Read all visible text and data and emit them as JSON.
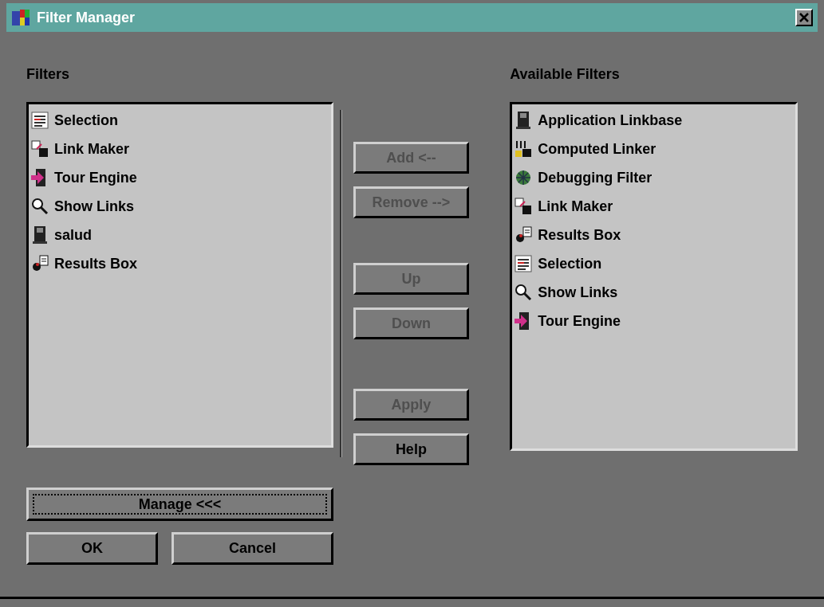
{
  "window": {
    "title": "Filter Manager"
  },
  "filters": {
    "label": "Filters",
    "items": [
      {
        "label": "Selection",
        "kind": "selection"
      },
      {
        "label": "Link Maker",
        "kind": "linker"
      },
      {
        "label": "Tour Engine",
        "kind": "tour"
      },
      {
        "label": "Show Links",
        "kind": "search"
      },
      {
        "label": "salud",
        "kind": "linkbase"
      },
      {
        "label": "Results Box",
        "kind": "results"
      }
    ]
  },
  "button_groups": [
    [
      {
        "label": "Add <--",
        "disabled": true
      },
      {
        "label": "Remove -->",
        "disabled": true
      }
    ],
    [
      {
        "label": "Up",
        "disabled": true
      },
      {
        "label": "Down",
        "disabled": true
      }
    ],
    [
      {
        "label": "Apply",
        "disabled": true
      }
    ],
    [
      {
        "label": "Help",
        "disabled": false
      }
    ]
  ],
  "available_filters": {
    "label": "Available Filters",
    "items": [
      {
        "label": "Application Linkbase",
        "kind": "linkbase"
      },
      {
        "label": "Computed Linker",
        "kind": "computed"
      },
      {
        "label": "Debugging Filter",
        "kind": "debug"
      },
      {
        "label": "Link Maker",
        "kind": "linker"
      },
      {
        "label": "Results Box",
        "kind": "results"
      },
      {
        "label": "Selection",
        "kind": "selection"
      },
      {
        "label": "Show Links",
        "kind": "search"
      },
      {
        "label": "Tour Engine",
        "kind": "tour"
      }
    ]
  },
  "manage_button": {
    "label": "Manage <<<",
    "focused": true
  },
  "ok_button": {
    "label": "OK"
  },
  "cancel_button": {
    "label": "Cancel"
  }
}
